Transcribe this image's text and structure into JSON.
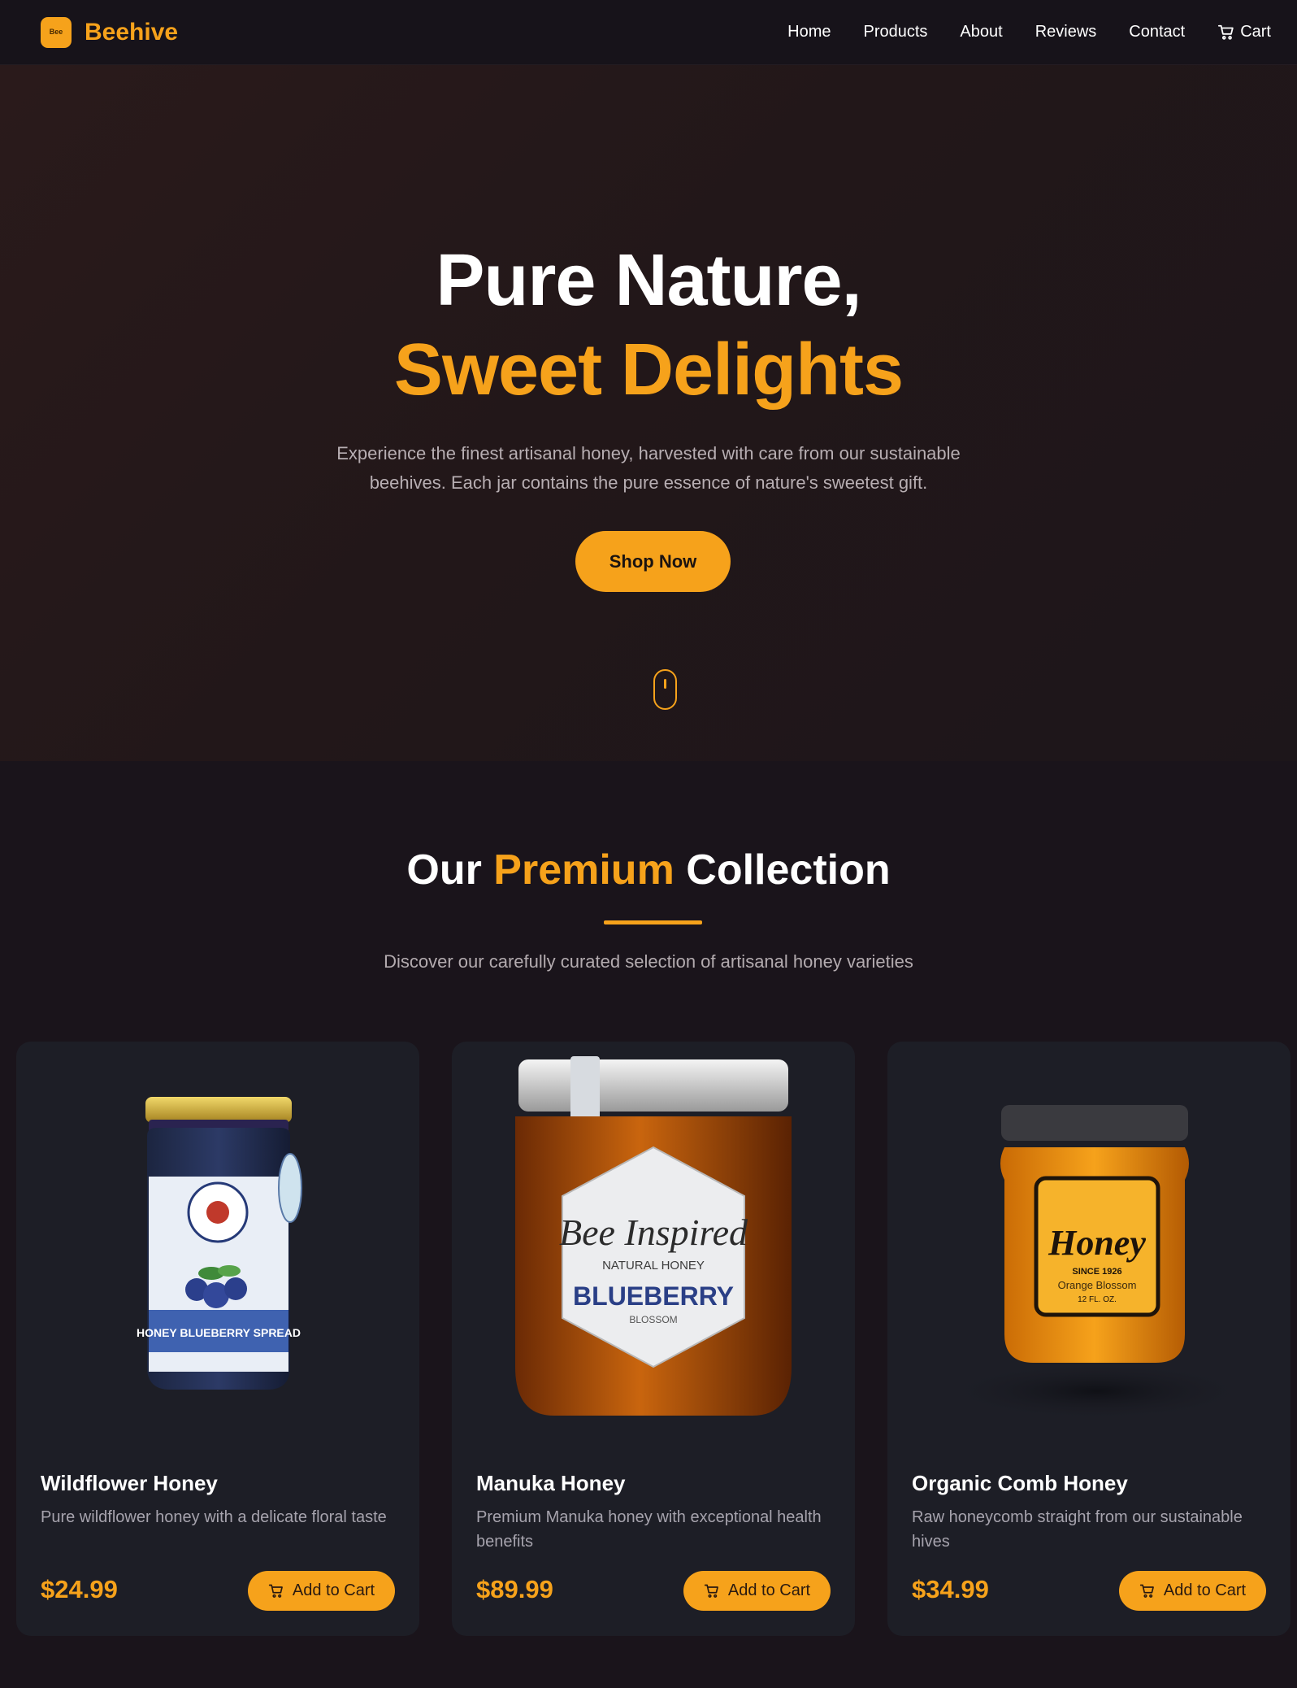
{
  "nav": {
    "brand": "Beehive",
    "logo_text": "Bee",
    "links": [
      {
        "label": "Home"
      },
      {
        "label": "Products"
      },
      {
        "label": "About"
      },
      {
        "label": "Reviews"
      },
      {
        "label": "Contact"
      },
      {
        "label": "Cart",
        "icon": "cart-icon"
      }
    ]
  },
  "hero": {
    "title_line1": "Pure Nature,",
    "title_line2": "Sweet Delights",
    "description": "Experience the finest artisanal honey, harvested with care from our sustainable beehives. Each jar contains the pure essence of nature's sweetest gift.",
    "cta_label": "Shop Now"
  },
  "collection": {
    "title_prefix": "Our",
    "title_accent": "Premium",
    "title_suffix": "Collection",
    "subtitle": "Discover our carefully curated selection of artisanal honey varieties",
    "products": [
      {
        "name": "Wildflower Honey",
        "description": "Pure wildflower honey with a delicate floral taste",
        "price": "$24.99",
        "button_label": "Add to Cart",
        "image_label": "HONEY BLUEBERRY SPREAD"
      },
      {
        "name": "Manuka Honey",
        "description": "Premium Manuka honey with exceptional health benefits",
        "price": "$89.99",
        "button_label": "Add to Cart",
        "image_label_1": "Bee Inspired",
        "image_label_2": "NATURAL HONEY",
        "image_label_3": "BLUEBERRY",
        "image_label_4": "BLOSSOM"
      },
      {
        "name": "Organic Comb Honey",
        "description": "Raw honeycomb straight from our sustainable hives",
        "price": "$34.99",
        "button_label": "Add to Cart",
        "image_label_1": "Honey",
        "image_label_2": "SINCE 1926",
        "image_label_3": "Orange Blossom",
        "image_label_4": "12 FL. OZ."
      }
    ]
  },
  "colors": {
    "accent": "#f6a21b",
    "background": "#1a141b",
    "card": "#1d1e26"
  }
}
